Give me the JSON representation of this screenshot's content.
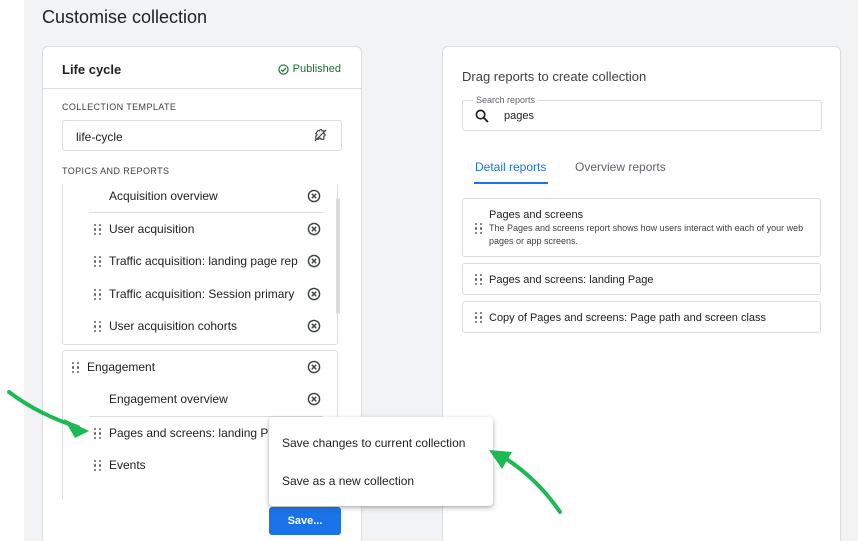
{
  "page": {
    "title": "Customise collection"
  },
  "collection": {
    "name": "Life cycle",
    "status": "Published",
    "template_label": "COLLECTION TEMPLATE",
    "template_value": "life-cycle",
    "topics_label": "TOPICS AND REPORTS"
  },
  "acquisition": {
    "items": [
      "Acquisition overview",
      "User acquisition",
      "Traffic acquisition: landing page rep",
      "Traffic acquisition: Session primary",
      "User acquisition cohorts"
    ]
  },
  "engagement": {
    "name": "Engagement",
    "items": [
      "Engagement overview",
      "Pages and screens: landing Pa",
      "Events"
    ]
  },
  "save_button": "Save...",
  "menu": {
    "items": [
      "Save changes to current collection",
      "Save as a new collection"
    ]
  },
  "reports_panel": {
    "hint": "Drag reports to create collection",
    "search_label": "Search reports",
    "search_value": "pages",
    "tabs": [
      "Detail reports",
      "Overview reports"
    ],
    "results": [
      {
        "title": "Pages and screens",
        "description": "The Pages and screens report shows how users interact with each of your web pages or app screens."
      },
      {
        "title": "Pages and screens: landing Page"
      },
      {
        "title": "Copy of Pages and screens: Page path and screen class"
      }
    ]
  },
  "colors": {
    "accent": "#1a73e8",
    "published": "#137333",
    "annotation_arrow": "#1db954"
  },
  "icons": [
    "check-circle-icon",
    "puzzle-icon",
    "drag-handle-icon",
    "remove-circle-icon",
    "search-icon"
  ]
}
